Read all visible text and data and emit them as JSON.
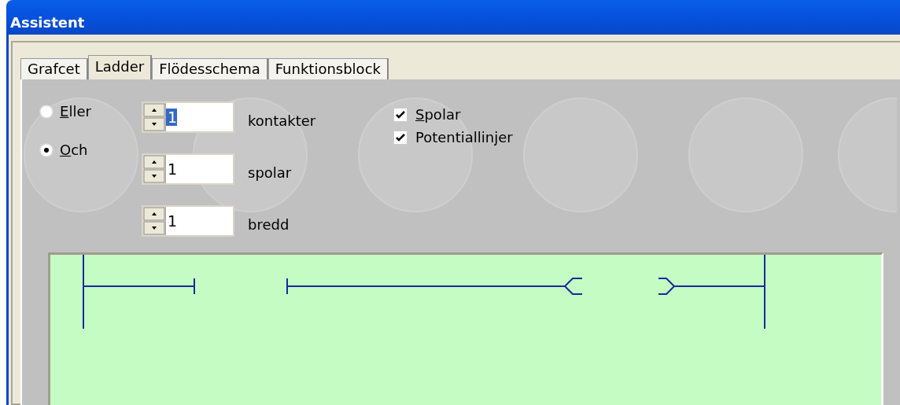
{
  "window": {
    "title": "Assistent"
  },
  "tabs": [
    {
      "label": "Grafcet",
      "selected": false
    },
    {
      "label": "Ladder",
      "selected": true
    },
    {
      "label": "Flödesschema",
      "selected": false
    },
    {
      "label": "Funktionsblock",
      "selected": false
    }
  ],
  "options": [
    {
      "label": "Eller",
      "first_letter_underlined": true,
      "selected": false
    },
    {
      "label": "Och",
      "first_letter_underlined": true,
      "selected": true
    }
  ],
  "spinners": [
    {
      "value": "1",
      "highlighted": true,
      "label": "kontakter"
    },
    {
      "value": "1",
      "highlighted": false,
      "label": "spolar"
    },
    {
      "value": "1",
      "highlighted": false,
      "label": "bredd"
    }
  ],
  "checkboxes": [
    {
      "label": "Spolar",
      "first_letter_underlined": true,
      "checked": true
    },
    {
      "label": "Potentiallinjer",
      "first_letter_underlined": false,
      "checked": true
    }
  ]
}
